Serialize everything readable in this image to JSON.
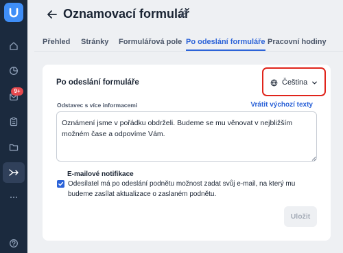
{
  "sidebar": {
    "items": [
      {
        "icon": "home-icon"
      },
      {
        "icon": "clock-icon"
      },
      {
        "icon": "inbox-icon",
        "badge": "9+"
      },
      {
        "icon": "clipboard-icon"
      },
      {
        "icon": "folder-icon"
      },
      {
        "icon": "redirect-icon",
        "active": true
      },
      {
        "icon": "more-icon"
      },
      {
        "icon": "help-icon"
      }
    ]
  },
  "header": {
    "title": "Oznamovací formulář"
  },
  "tabs": [
    {
      "label": "Přehled"
    },
    {
      "label": "Stránky"
    },
    {
      "label": "Formulářová pole"
    },
    {
      "label": "Po odeslání formuláře",
      "active": true
    },
    {
      "label": "Pracovní hodiny"
    }
  ],
  "card": {
    "title": "Po odeslání formuláře",
    "language": "Čeština",
    "field_label": "Odstavec s více informacemi",
    "reset_link": "Vrátit výchozí texty",
    "message": "Oznámení jsme v pořádku obdrželi. Budeme se mu věnovat v nejbližším možném čase a odpovíme Vám.",
    "notifications_title": "E-mailové notifikace",
    "notifications_checked": true,
    "notifications_text": "Odesílatel má po odeslání podnětu možnost zadat svůj e-mail, na který mu budeme zasílat aktualizace o zaslaném podnětu.",
    "save_label": "Uložit"
  },
  "colors": {
    "sidebar_bg": "#1b2a3e",
    "accent": "#2c63d8",
    "badge": "#e5484d",
    "highlight": "#e0241b"
  }
}
